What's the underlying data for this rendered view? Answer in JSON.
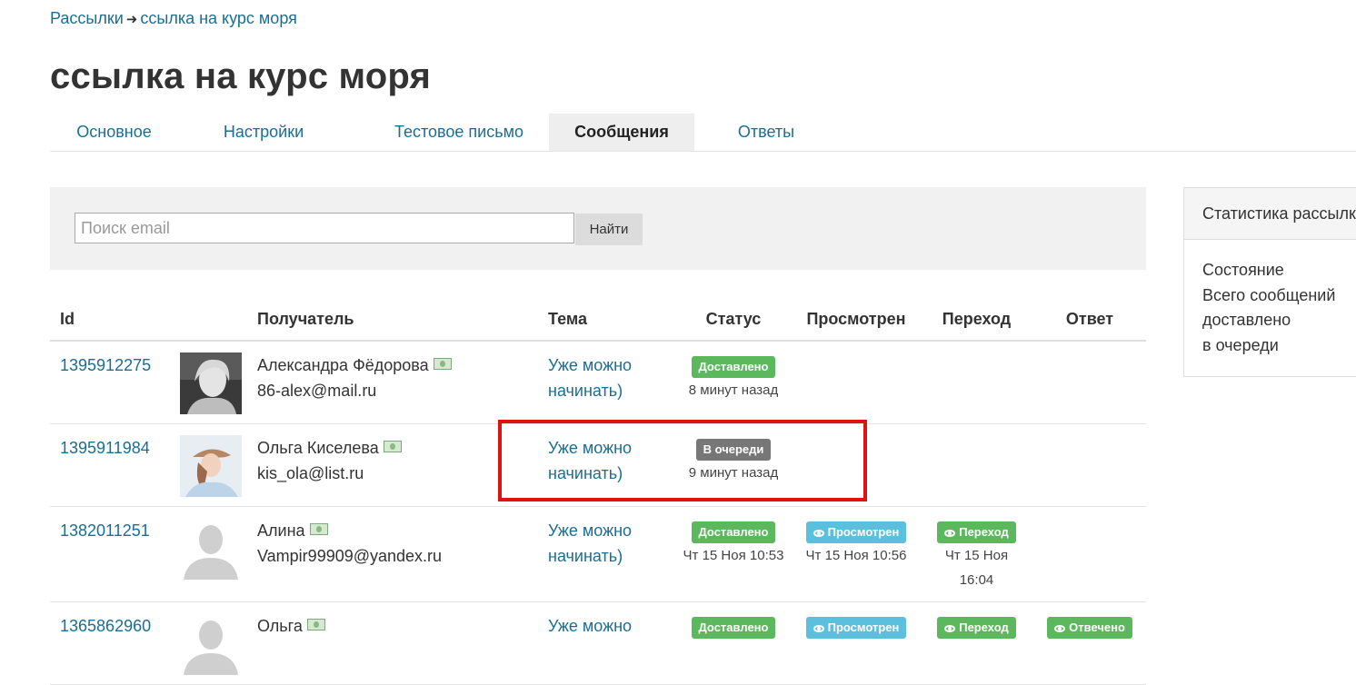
{
  "breadcrumb": {
    "parent": "Рассылки",
    "separator": "➜",
    "current": "ссылка на курс моря"
  },
  "page_title": "ссылка на курс моря",
  "tabs": [
    {
      "label": "Основное",
      "active": false
    },
    {
      "label": "Настройки",
      "active": false
    },
    {
      "label": "Тестовое письмо",
      "active": false
    },
    {
      "label": "Сообщения",
      "active": true
    },
    {
      "label": "Ответы",
      "active": false
    }
  ],
  "search": {
    "placeholder": "Поиск email",
    "value": "",
    "button_label": "Найти"
  },
  "table": {
    "headers": [
      "Id",
      "",
      "Получатель",
      "Тема",
      "Статус",
      "Просмотрен",
      "Переход",
      "Ответ"
    ],
    "rows": [
      {
        "id": "1395912275",
        "name": "Александра Фёдорова",
        "email": "86-alex@mail.ru",
        "subject_l1": "Уже можно",
        "subject_l2": "начинать)",
        "status_label": "Доставлено",
        "status_time": "8 минут назад",
        "viewed_label": "",
        "viewed_time": "",
        "click_label": "",
        "click_time_l1": "",
        "click_time_l2": "",
        "reply_label": ""
      },
      {
        "id": "1395911984",
        "name": "Ольга Киселева",
        "email": "kis_ola@list.ru",
        "subject_l1": "Уже можно",
        "subject_l2": "начинать)",
        "status_label": "В очереди",
        "status_time": "9 минут назад",
        "viewed_label": "",
        "viewed_time": "",
        "click_label": "",
        "click_time_l1": "",
        "click_time_l2": "",
        "reply_label": ""
      },
      {
        "id": "1382011251",
        "name": "Алина",
        "email": "Vampir99909@yandex.ru",
        "subject_l1": "Уже можно",
        "subject_l2": "начинать)",
        "status_label": "Доставлено",
        "status_time": "Чт 15 Ноя 10:53",
        "viewed_label": "Просмотрен",
        "viewed_time": "Чт 15 Ноя 10:56",
        "click_label": "Переход",
        "click_time_l1": "Чт 15 Ноя",
        "click_time_l2": "16:04",
        "reply_label": ""
      },
      {
        "id": "1365862960",
        "name": "Ольга",
        "email": "",
        "subject_l1": "Уже можно",
        "subject_l2": "",
        "status_label": "Доставлено",
        "status_time": "",
        "viewed_label": "Просмотрен",
        "viewed_time": "",
        "click_label": "Переход",
        "click_time_l1": "",
        "click_time_l2": "",
        "reply_label": "Отвечено"
      }
    ]
  },
  "stats": {
    "title": "Статистика рассылки",
    "items": [
      "Состояние",
      "Всего сообщений",
      "доставлено",
      "в очереди"
    ]
  },
  "colors": {
    "link": "#1a6e93",
    "badge_delivered": "#5cb85c",
    "badge_queued": "#777777",
    "badge_viewed": "#5bc0de",
    "highlight": "#e0120f"
  }
}
